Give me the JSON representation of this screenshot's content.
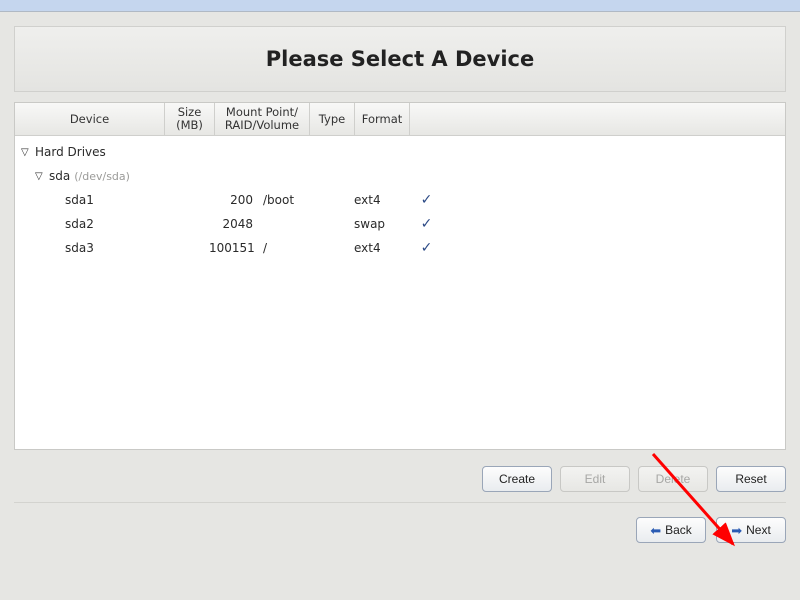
{
  "title": "Please Select A Device",
  "columns": {
    "device": "Device",
    "size": "Size\n(MB)",
    "mount": "Mount Point/\nRAID/Volume",
    "type": "Type",
    "format": "Format"
  },
  "tree": {
    "root_label": "Hard Drives",
    "disk": {
      "name": "sda",
      "path": "(/dev/sda)"
    },
    "partitions": [
      {
        "name": "sda1",
        "size": "200",
        "mount": "/boot",
        "type": "ext4",
        "format": true
      },
      {
        "name": "sda2",
        "size": "2048",
        "mount": "",
        "type": "swap",
        "format": true
      },
      {
        "name": "sda3",
        "size": "100151",
        "mount": "/",
        "type": "ext4",
        "format": true
      }
    ]
  },
  "buttons": {
    "create": "Create",
    "edit": "Edit",
    "delete": "Delete",
    "reset": "Reset",
    "back": "Back",
    "next": "Next"
  }
}
